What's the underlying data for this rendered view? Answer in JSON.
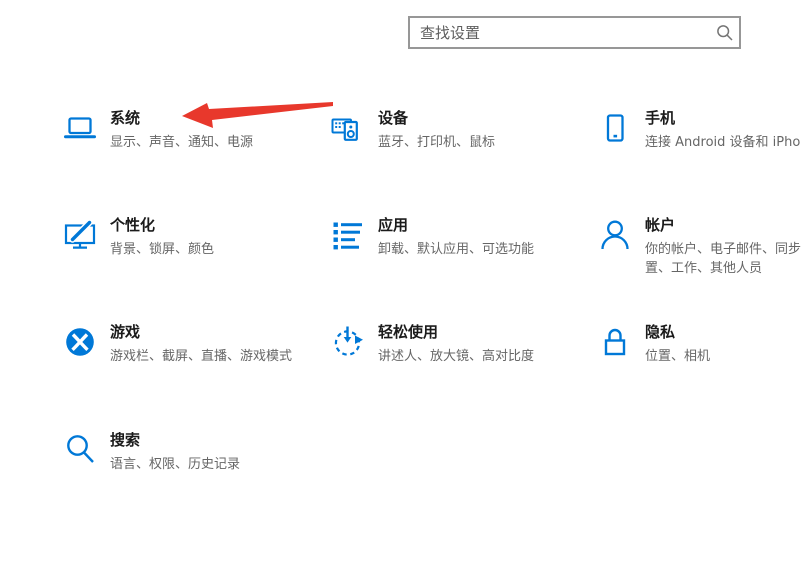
{
  "window": {
    "background": "#ffffff"
  },
  "search": {
    "placeholder": "查找设置",
    "icon": "magnifier-icon"
  },
  "tiles": [
    {
      "id": "system",
      "title": "系统",
      "subtitle": "显示、声音、通知、电源",
      "icon": "laptop-icon"
    },
    {
      "id": "devices",
      "title": "设备",
      "subtitle": "蓝牙、打印机、鼠标",
      "icon": "keyboard-speaker-icon"
    },
    {
      "id": "phone",
      "title": "手机",
      "subtitle": "连接 Android 设备和 iPhone",
      "icon": "smartphone-icon"
    },
    {
      "id": "personalization",
      "title": "个性化",
      "subtitle": "背景、锁屏、颜色",
      "icon": "monitor-brush-icon"
    },
    {
      "id": "apps",
      "title": "应用",
      "subtitle": "卸载、默认应用、可选功能",
      "icon": "bulleted-list-icon"
    },
    {
      "id": "accounts",
      "title": "帐户",
      "subtitle": "你的帐户、电子邮件、同步设\n置、工作、其他人员",
      "icon": "person-icon"
    },
    {
      "id": "gaming",
      "title": "游戏",
      "subtitle": "游戏栏、截屏、直播、游戏模式",
      "icon": "xbox-icon"
    },
    {
      "id": "ease-of-access",
      "title": "轻松使用",
      "subtitle": "讲述人、放大镜、高对比度",
      "icon": "dashed-circle-arrow-icon"
    },
    {
      "id": "privacy",
      "title": "隐私",
      "subtitle": "位置、相机",
      "icon": "lock-icon"
    },
    {
      "id": "search",
      "title": "搜索",
      "subtitle": "语言、权限、历史记录",
      "icon": "magnifier-icon"
    }
  ],
  "annotation": {
    "type": "red-arrow",
    "points_to": "系统"
  },
  "colors": {
    "accent": "#0078d7",
    "arrow_red": "#e8382c",
    "title_text": "#1b1b1b",
    "subtitle_text": "#666666",
    "search_border": "#979797",
    "search_placeholder": "#5e5e5e"
  }
}
